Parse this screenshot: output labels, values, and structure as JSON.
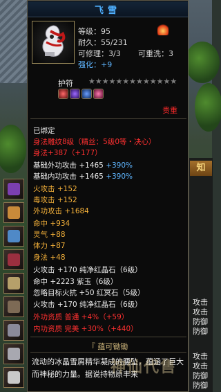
{
  "tooltip": {
    "title": "飞雪",
    "level_label": "等级：95",
    "durability_label": "耐久：55/231",
    "repairable_label": "可修理：3/3",
    "rewash_label": "可重洗：3",
    "enhance_prefix": "强化：",
    "enhance_value": "+9",
    "amulet_label": "护符",
    "stars": "★★★★★★★★★★★★★",
    "precious": "贵重",
    "bound": "已绑定",
    "carving": "身法雕纹8级（精丝：5级0等・决心）",
    "carving_bonus": "身法+387（+177）",
    "base_stats": [
      {
        "label": "基础外功攻击 +1465",
        "extra": "+390%"
      },
      {
        "label": "基础内功攻击 +1465",
        "extra": "+390%"
      }
    ],
    "attributes": [
      "火攻击 +152",
      "毒攻击 +152",
      "外功攻击 +1684",
      "命中 +934",
      "灵气 +88",
      "体力 +87",
      "身法 +48"
    ],
    "gems": [
      "火攻击 +170 纯净红晶石（6级）",
      "命中 +2223 紫玉（6级）",
      "忽略目标火抗 +50 红冥石（5级）",
      "火攻击 +170 纯净红晶石（6级）"
    ],
    "aptitudes": [
      "外功资质  普通  +4%（+59）",
      "内功资质  完美  +30%（+440）"
    ],
    "desc_title": "『 蕴可锄锄",
    "description": "流动的冰晶雪屑精华凝成的腰坠，蕴涵了巨大而神秘的力量。据说持物原丰来"
  },
  "right_panel": {
    "tab": "知",
    "labels": [
      "攻击",
      "攻击",
      "防御",
      "防御",
      "攻击",
      "攻击",
      "防御",
      "防御"
    ]
  },
  "watermark": "神仙代售",
  "colors": {
    "title_blue": "#4fb0ff",
    "bound_red": "#ff3030",
    "attr_orange": "#f6b23a",
    "percent_blue": "#5fb6ff"
  }
}
